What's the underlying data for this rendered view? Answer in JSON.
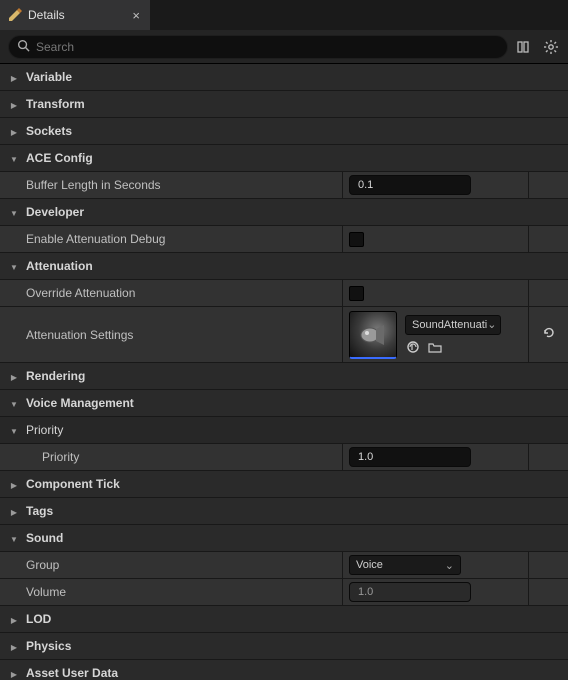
{
  "tab": {
    "title": "Details",
    "icon": "pencil-ruler-icon"
  },
  "search": {
    "placeholder": "Search"
  },
  "categories": {
    "variable": {
      "label": "Variable",
      "expanded": false
    },
    "transform": {
      "label": "Transform",
      "expanded": false
    },
    "sockets": {
      "label": "Sockets",
      "expanded": false
    },
    "ace": {
      "label": "ACE Config",
      "expanded": true,
      "buffer": {
        "label": "Buffer Length in Seconds",
        "value": "0.1"
      }
    },
    "developer": {
      "label": "Developer",
      "expanded": true,
      "attenDebug": {
        "label": "Enable Attenuation Debug",
        "checked": false
      }
    },
    "attenuation": {
      "label": "Attenuation",
      "expanded": true,
      "override": {
        "label": "Override Attenuation",
        "checked": false
      },
      "settings": {
        "label": "Attenuation Settings",
        "asset": "SoundAttenuati"
      }
    },
    "rendering": {
      "label": "Rendering",
      "expanded": false
    },
    "voice": {
      "label": "Voice Management",
      "expanded": true,
      "priority": {
        "label": "Priority",
        "expanded": true,
        "row": {
          "label": "Priority",
          "value": "1.0"
        }
      }
    },
    "compTick": {
      "label": "Component Tick",
      "expanded": false
    },
    "tags": {
      "label": "Tags",
      "expanded": false
    },
    "sound": {
      "label": "Sound",
      "expanded": true,
      "group": {
        "label": "Group",
        "value": "Voice"
      },
      "volume": {
        "label": "Volume",
        "value": "1.0"
      }
    },
    "lod": {
      "label": "LOD",
      "expanded": false
    },
    "physics": {
      "label": "Physics",
      "expanded": false
    },
    "assetUser": {
      "label": "Asset User Data",
      "expanded": false
    }
  }
}
